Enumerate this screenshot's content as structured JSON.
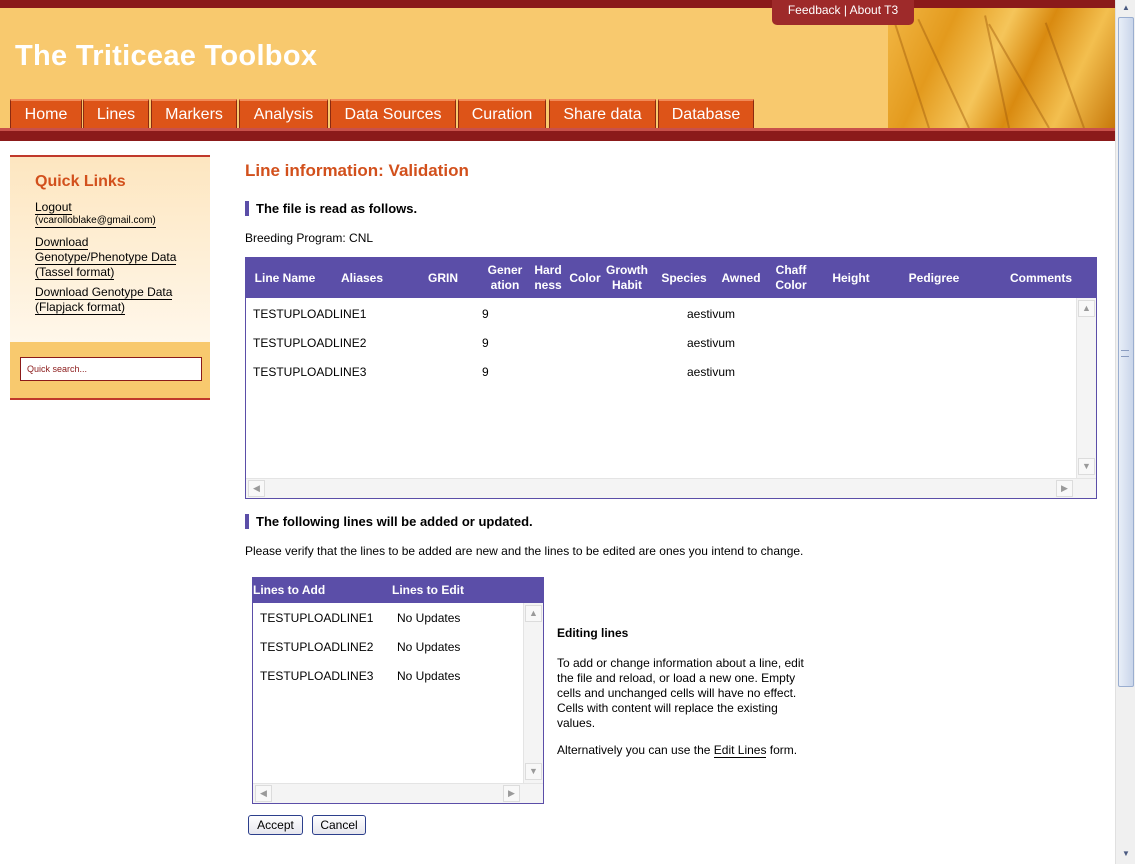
{
  "header": {
    "site_title": "The Triticeae Toolbox",
    "feedback_label": "Feedback",
    "about_label": "About T3",
    "nav": [
      "Home",
      "Lines",
      "Markers",
      "Analysis",
      "Data Sources",
      "Curation",
      "Share data",
      "Database"
    ]
  },
  "sidebar": {
    "title": "Quick Links",
    "logout": "Logout",
    "email": "(vcarolloblake@gmail.com)",
    "download1": [
      "Download",
      "Genotype/Phenotype Data",
      "(Tassel format)"
    ],
    "download2": [
      "Download Genotype Data",
      "(Flapjack format)"
    ],
    "search_placeholder": "Quick search..."
  },
  "main": {
    "title": "Line information: Validation",
    "section1": "The file is read as follows.",
    "breeding_program": "Breeding Program: CNL",
    "columns": [
      "Line Name",
      "Aliases",
      "GRIN",
      "Gener\nation",
      "Hard\nness",
      "Color",
      "Growth\nHabit",
      "Species",
      "Awned",
      "Chaff\nColor",
      "Height",
      "Pedigree",
      "Comments"
    ],
    "rows": [
      {
        "line_name": "TESTUPLOADLINE1",
        "generation": "9",
        "species": "aestivum"
      },
      {
        "line_name": "TESTUPLOADLINE2",
        "generation": "9",
        "species": "aestivum"
      },
      {
        "line_name": "TESTUPLOADLINE3",
        "generation": "9",
        "species": "aestivum"
      }
    ],
    "section2": "The following lines will be added or updated.",
    "verify_text": "Please verify that the lines to be added are new and the lines to be edited are ones you intend to change.",
    "lines_columns": [
      "Lines to Add",
      "Lines to Edit"
    ],
    "lines_rows": [
      {
        "add": "TESTUPLOADLINE1",
        "edit": "No Updates"
      },
      {
        "add": "TESTUPLOADLINE2",
        "edit": "No Updates"
      },
      {
        "add": "TESTUPLOADLINE3",
        "edit": "No Updates"
      }
    ],
    "editing_title": "Editing lines",
    "editing_text": "To add or change information about a line, edit the file and reload, or load a new one. Empty cells and unchanged cells will have no effect. Cells with content will replace the existing values.",
    "alt_prefix": "Alternatively you can use the ",
    "alt_link": "Edit Lines",
    "alt_suffix": " form.",
    "accept_label": "Accept",
    "cancel_label": "Cancel"
  },
  "colors": {
    "header_bg": "#f8c96e",
    "header_bar": "#8b1a1a",
    "nav_tab": "#dd5418",
    "accent_title": "#d2501c",
    "table_header": "#5b4ea8"
  }
}
